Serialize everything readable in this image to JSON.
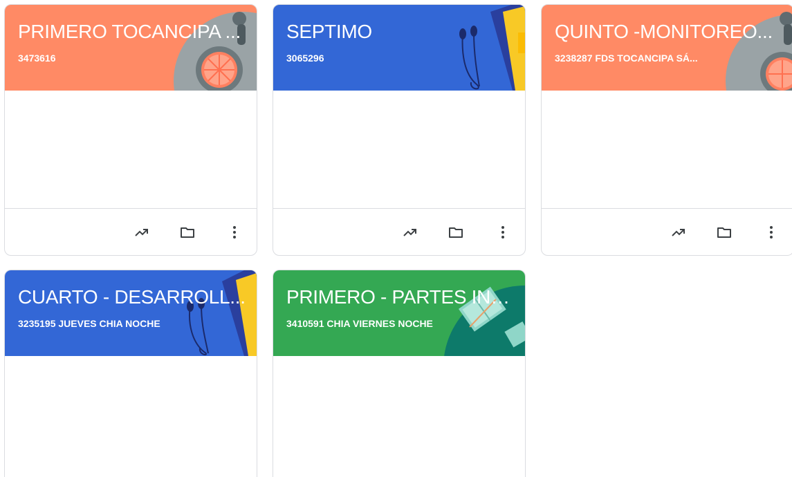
{
  "colors": {
    "orange": "#ff8a65",
    "blue": "#3367d6",
    "green": "#34a853",
    "icon": "#3c4043",
    "border": "#dadce0"
  },
  "classes": [
    {
      "title": "PRIMERO TOCANCIPA ...",
      "section": "3473616",
      "theme": "orange",
      "illustration": "lime-plate"
    },
    {
      "title": "SEPTIMO",
      "section": "3065296",
      "theme": "blue",
      "illustration": "book-headphones"
    },
    {
      "title": "QUINTO -MONITOREO...",
      "section": "3238287 FDS TOCANCIPA SÁ...",
      "theme": "orange",
      "illustration": "lime-plate"
    },
    {
      "title": "CUARTO - DESARROLL...",
      "section": "3235195 JUEVES CHIA NOCHE",
      "theme": "blue",
      "illustration": "book-headphones"
    },
    {
      "title": "PRIMERO - PARTES INT...",
      "section": "3410591 CHIA VIERNES NOCHE",
      "theme": "green",
      "illustration": "open-books"
    }
  ],
  "icons": {
    "trend": "trending-up-icon",
    "folder": "folder-icon",
    "more": "more-vert-icon"
  }
}
